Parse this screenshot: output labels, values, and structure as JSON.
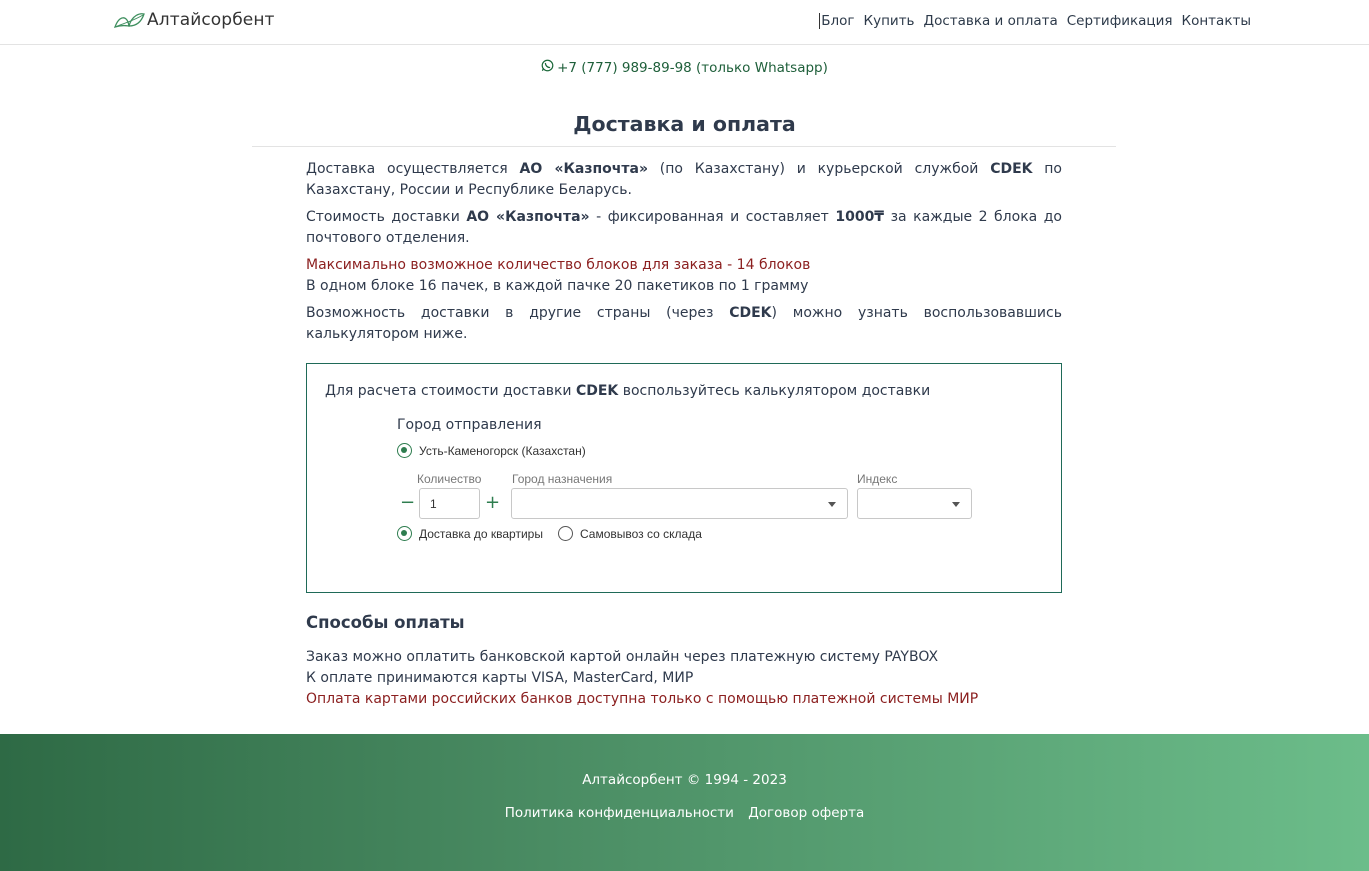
{
  "header": {
    "logo_text": "Алтайсорбент",
    "nav": [
      "Блог",
      "Купить",
      "Доставка и оплата",
      "Сертификация",
      "Контакты"
    ]
  },
  "whatsapp": {
    "text": "+7 (777) 989-89-98 (только Whatsapp)"
  },
  "page": {
    "title": "Доставка и оплата"
  },
  "delivery": {
    "p1": {
      "a": "Доставка осуществляется ",
      "b1": "АО «Казпочта»",
      "c": " (по Казахстану) и курьерской службой ",
      "b2": "CDEK",
      "d": " по Казахстану, России и Республике Беларусь."
    },
    "p2": {
      "a": "Стоимость доставки ",
      "b1": "АО «Казпочта»",
      "c": " - фиксированная и составляет ",
      "b2": "1000₸",
      "d": " за каждые 2 блока до почтового отделения."
    },
    "max_blocks": "Максимально возможное количество блоков для заказа - 14 блоков",
    "block_info": "В одном блоке 16 пачек, в каждой пачке 20 пакетиков по 1 грамму",
    "p4": {
      "a": "Возможность доставки в другие страны (через ",
      "b": "CDEK",
      "c": ") можно узнать воспользовавшись калькулятором ниже."
    }
  },
  "calculator": {
    "intro_a": "Для расчета стоимости доставки ",
    "intro_b": "CDEK",
    "intro_c": " воспользуйтесь калькулятором доставки",
    "from_label": "Город отправления",
    "from_city": "Усть-Каменогорск (Казахстан)",
    "qty_label": "Количество",
    "qty_value": "1",
    "minus": "−",
    "plus": "+",
    "dest_label": "Город назначения",
    "index_label": "Индекс",
    "option_door": "Доставка до квартиры",
    "option_pickup": "Самовывоз со склада",
    "selected_option": "door",
    "accent_color": "#2e7d4f"
  },
  "payment": {
    "title": "Способы оплаты",
    "line1": "Заказ можно оплатить банковской картой онлайн через платежную систему PAYBOX",
    "line2": "К оплате принимаются карты VISA, MasterCard, МИР",
    "line3": "Оплата картами российских банков доступна только с помощью платежной системы МИР"
  },
  "footer": {
    "copyright": "Алтайсорбент © 1994 - 2023",
    "privacy": "Политика конфиденциальности",
    "offer": "Договор оферта"
  }
}
